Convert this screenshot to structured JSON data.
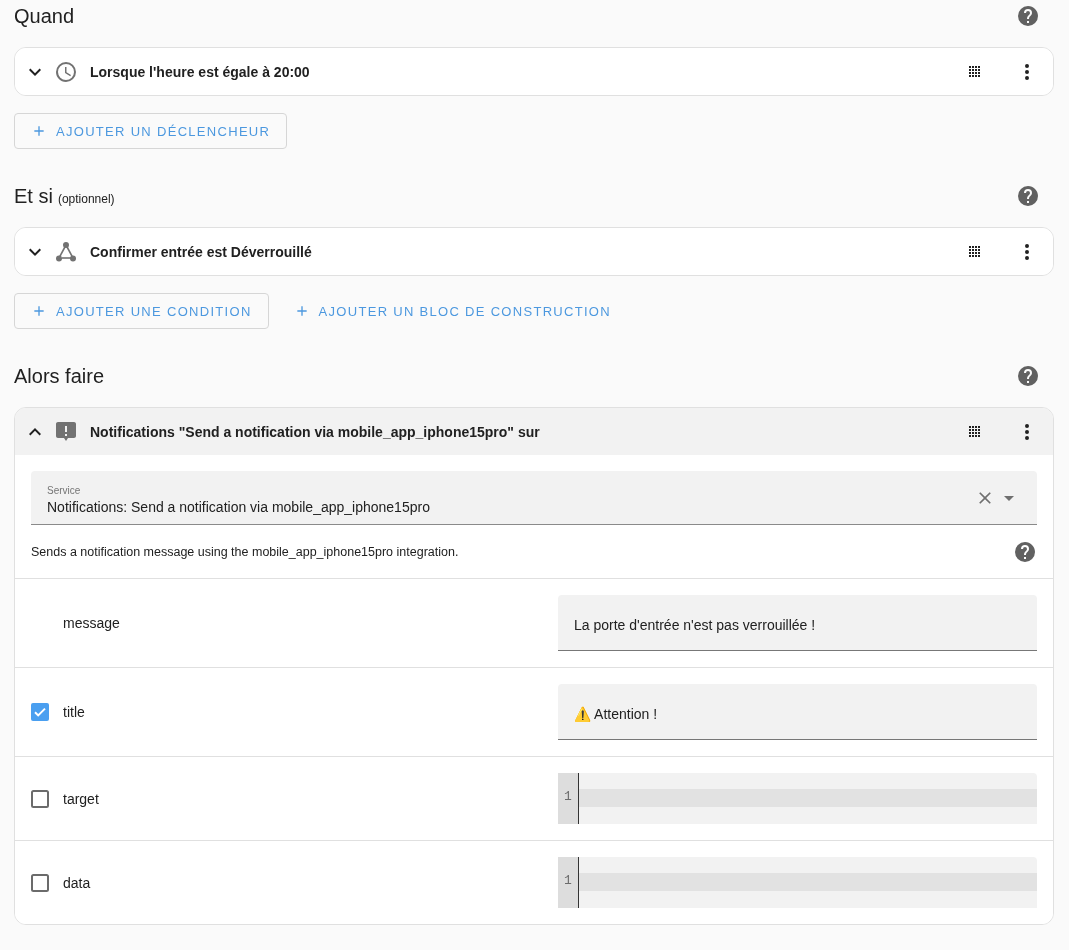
{
  "sections": [
    {
      "title": "Quand",
      "cards": [
        {
          "label": "Lorsque l'heure est égale à 20:00",
          "kind": "time_trigger",
          "expanded": false
        }
      ],
      "buttons": [
        {
          "label": "AJOUTER UN DÉCLENCHEUR",
          "outlined": true
        }
      ]
    },
    {
      "title": "Et si",
      "note": "(optionnel)",
      "cards": [
        {
          "label": "Confirmer entrée est Déverrouillé",
          "kind": "state_condition",
          "expanded": false
        }
      ],
      "buttons": [
        {
          "label": "AJOUTER UNE CONDITION",
          "outlined": true
        },
        {
          "label": "AJOUTER UN BLOC DE CONSTRUCTION",
          "outlined": false
        }
      ]
    },
    {
      "title": "Alors faire",
      "cards": [
        {
          "label": "Notifications \"Send a notification via mobile_app_iphone15pro\" sur",
          "kind": "service_action",
          "expanded": true,
          "service": {
            "label": "Service",
            "value": "Notifications: Send a notification via mobile_app_iphone15pro"
          },
          "description": "Sends a notification message using the mobile_app_iphone15pro integration.",
          "params": [
            {
              "name": "message",
              "optional": false,
              "kind": "text",
              "value": "La porte d'entrée n'est pas verrouillée !"
            },
            {
              "name": "title",
              "optional": true,
              "checked": true,
              "kind": "text",
              "value": "⚠️ Attention !"
            },
            {
              "name": "target",
              "optional": true,
              "checked": false,
              "kind": "code",
              "line_number": "1"
            },
            {
              "name": "data",
              "optional": true,
              "checked": false,
              "kind": "code",
              "line_number": "1"
            }
          ]
        }
      ]
    }
  ]
}
